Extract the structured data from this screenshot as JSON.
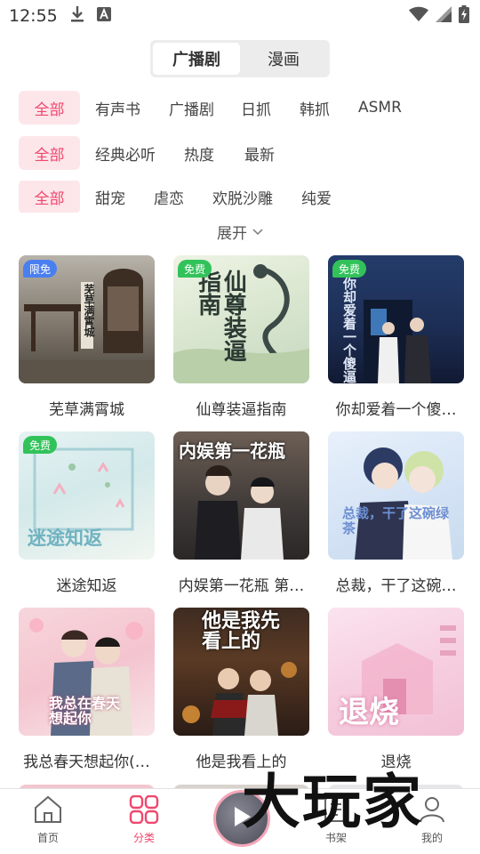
{
  "status_bar": {
    "time": "12:55",
    "icons": [
      "download-icon",
      "app-notification-icon",
      "wifi-icon",
      "signal-icon",
      "battery-charging-icon"
    ]
  },
  "segment": {
    "tabs": [
      {
        "label": "广播剧",
        "active": true
      },
      {
        "label": "漫画",
        "active": false
      }
    ]
  },
  "filters": {
    "row1": [
      "全部",
      "有声书",
      "广播剧",
      "日抓",
      "韩抓",
      "ASMR"
    ],
    "row2": [
      "全部",
      "经典必听",
      "热度",
      "最新"
    ],
    "row3": [
      "全部",
      "甜宠",
      "虐恋",
      "欢脱沙雕",
      "纯爱"
    ],
    "expand_label": "展开",
    "accent_color": "#f0476d",
    "active_bg": "#fde6ea"
  },
  "cards": [
    {
      "title": "芜草满霄城",
      "badge": "限免",
      "cover_text": "芜草满霄城"
    },
    {
      "title": "仙尊装逼指南",
      "badge": "免费",
      "cover_text": "仙尊装逼指南"
    },
    {
      "title": "你却爱着一个傻…",
      "badge": "免费",
      "cover_text": "你却爱着一个傻逼"
    },
    {
      "title": "迷途知返",
      "badge": "免费",
      "cover_text": "迷途知返"
    },
    {
      "title": "内娱第一花瓶 第…",
      "badge": "",
      "cover_text": "内娱第一花瓶"
    },
    {
      "title": "总裁，干了这碗…",
      "badge": "",
      "cover_text": "总裁，干了这碗绿茶"
    },
    {
      "title": "我总春天想起你(…",
      "badge": "",
      "cover_text": "我总在春天想起你"
    },
    {
      "title": "他是我看上的",
      "badge": "",
      "cover_text": "他是我先看上的"
    },
    {
      "title": "退烧",
      "badge": "",
      "cover_text": "退烧"
    }
  ],
  "tabbar": {
    "items": [
      {
        "label": "首页",
        "icon": "home-icon",
        "active": false
      },
      {
        "label": "分类",
        "icon": "category-icon",
        "active": true
      },
      {
        "label": "",
        "icon": "play-icon",
        "active": false
      },
      {
        "label": "书架",
        "icon": "bookshelf-icon",
        "active": false
      },
      {
        "label": "我的",
        "icon": "profile-icon",
        "active": false
      }
    ]
  },
  "watermark": "大玩家"
}
